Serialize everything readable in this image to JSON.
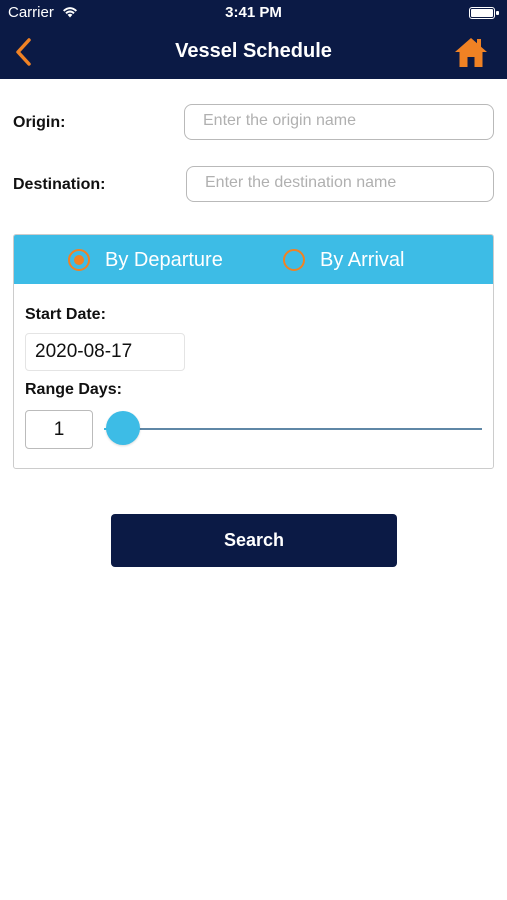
{
  "status_bar": {
    "carrier": "Carrier",
    "time": "3:41 PM"
  },
  "header": {
    "title": "Vessel Schedule",
    "back_icon": "chevron-left-icon",
    "home_icon": "home-icon"
  },
  "form": {
    "origin": {
      "label": "Origin:",
      "placeholder": "Enter the origin name"
    },
    "destination": {
      "label": "Destination:",
      "placeholder": "Enter the destination name"
    }
  },
  "options": {
    "by_departure": "By Departure",
    "by_arrival": "By Arrival",
    "selected": "By Departure",
    "start_date_label": "Start Date:",
    "start_date_value": "2020-08-17",
    "range_days_label": "Range Days:",
    "range_days_value": "1"
  },
  "search_button": "Search",
  "colors": {
    "navy": "#0b1a45",
    "accent_blue": "#3dbce6",
    "orange": "#f08224"
  }
}
